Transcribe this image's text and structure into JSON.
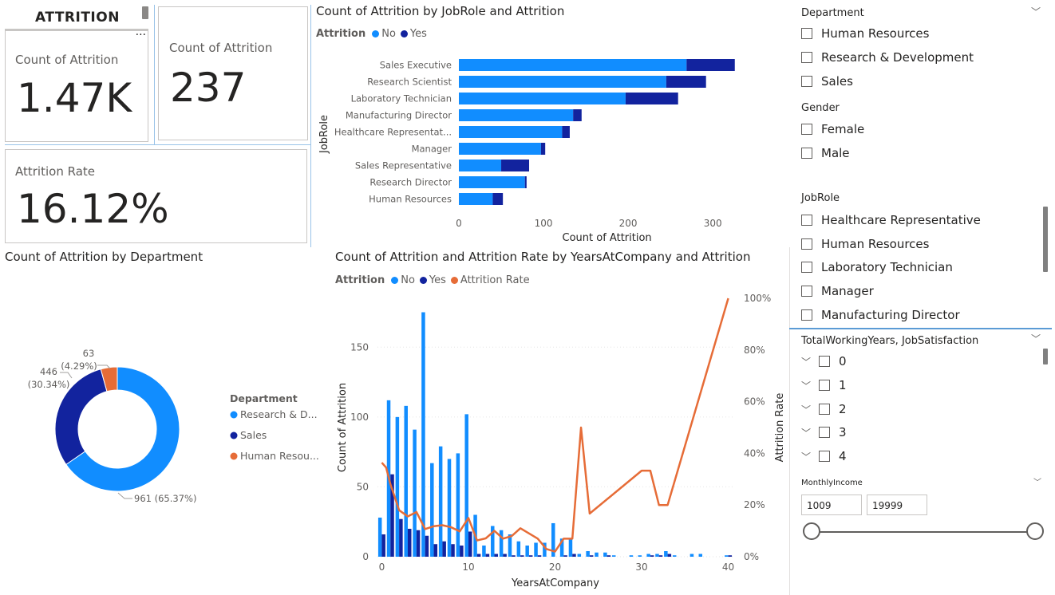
{
  "header": {
    "title": "ATTRITION"
  },
  "cards": {
    "total": {
      "label": "Count of Attrition",
      "value": "1.47K"
    },
    "yes": {
      "label": "Count of Attrition",
      "value": "237"
    },
    "rate": {
      "label": "Attrition Rate",
      "value": "16.12%"
    }
  },
  "more_options_glyph": "···",
  "colors": {
    "no": "#118DFF",
    "yes": "#12239E",
    "rate": "#E66C37",
    "hr": "#E66C37"
  },
  "jobrole_chart": {
    "title": "Count of Attrition by JobRole and Attrition",
    "legend_title": "Attrition",
    "legend_no": "No",
    "legend_yes": "Yes",
    "ylabel": "JobRole",
    "xlabel": "Count of Attrition"
  },
  "dept_chart": {
    "title": "Count of Attrition by Department",
    "legend_title": "Department",
    "legend_items": [
      "Research & D...",
      "Sales",
      "Human Resou..."
    ],
    "label_hr_count": "63",
    "label_hr_pct": "(4.29%)",
    "label_sales_count": "446",
    "label_sales_pct": "(30.34%)",
    "label_rd": "961 (65.37%)"
  },
  "years_chart": {
    "title": "Count of Attrition and Attrition Rate by YearsAtCompany and Attrition",
    "legend_title": "Attrition",
    "legend_no": "No",
    "legend_yes": "Yes",
    "legend_rate": "Attrition Rate",
    "ylabel": "Count of Attrition",
    "y2label": "Attrition Rate",
    "xlabel": "YearsAtCompany"
  },
  "slicers": {
    "department": {
      "title": "Department",
      "items": [
        "Human Resources",
        "Research & Development",
        "Sales"
      ]
    },
    "gender": {
      "title": "Gender",
      "items": [
        "Female",
        "Male"
      ]
    },
    "jobrole": {
      "title": "JobRole",
      "items": [
        "Healthcare Representative",
        "Human Resources",
        "Laboratory Technician",
        "Manager",
        "Manufacturing Director"
      ]
    },
    "twy": {
      "title": "TotalWorkingYears, JobSatisfaction",
      "items": [
        "0",
        "1",
        "2",
        "3",
        "4"
      ]
    },
    "income": {
      "title": "MonthlyIncome",
      "min": "1009",
      "max": "19999",
      "range": [
        1009,
        19999
      ]
    }
  },
  "chart_data": [
    {
      "type": "bar",
      "orientation": "horizontal",
      "stacked": true,
      "title": "Count of Attrition by JobRole and Attrition",
      "xlabel": "Count of Attrition",
      "ylabel": "JobRole",
      "categories": [
        "Sales Executive",
        "Research Scientist",
        "Laboratory Technician",
        "Manufacturing Director",
        "Healthcare Representat...",
        "Manager",
        "Sales Representative",
        "Research Director",
        "Human Resources"
      ],
      "series": [
        {
          "name": "No",
          "values": [
            269,
            245,
            197,
            135,
            122,
            97,
            50,
            78,
            40
          ]
        },
        {
          "name": "Yes",
          "values": [
            57,
            47,
            62,
            10,
            9,
            5,
            33,
            2,
            12
          ]
        }
      ],
      "xlim": [
        0,
        330
      ],
      "xticks": [
        0,
        100,
        200,
        300
      ],
      "legend": "top-left"
    },
    {
      "type": "pie",
      "donut": true,
      "title": "Count of Attrition by Department",
      "categories": [
        "Research & D...",
        "Sales",
        "Human Resou..."
      ],
      "values": [
        961,
        446,
        63
      ],
      "percents": [
        65.37,
        30.34,
        4.29
      ],
      "legend": "right"
    },
    {
      "type": "bar",
      "combo": "line",
      "title": "Count of Attrition and Attrition Rate by YearsAtCompany and Attrition",
      "xlabel": "YearsAtCompany",
      "ylabel": "Count of Attrition",
      "y2label": "Attrition Rate",
      "x": [
        0,
        1,
        2,
        3,
        4,
        5,
        6,
        7,
        8,
        9,
        10,
        11,
        12,
        13,
        14,
        15,
        16,
        17,
        18,
        19,
        20,
        21,
        22,
        23,
        24,
        25,
        26,
        27,
        29,
        30,
        31,
        32,
        33,
        34,
        36,
        37,
        40
      ],
      "series": [
        {
          "name": "No",
          "values": [
            28,
            112,
            100,
            108,
            91,
            175,
            67,
            79,
            70,
            74,
            102,
            30,
            8,
            22,
            19,
            16,
            11,
            8,
            10,
            10,
            24,
            13,
            13,
            2,
            4,
            3,
            3,
            1,
            1,
            1,
            2,
            2,
            4,
            1,
            2,
            2,
            1
          ]
        },
        {
          "name": "Yes",
          "values": [
            16,
            59,
            27,
            20,
            19,
            15,
            9,
            11,
            9,
            8,
            18,
            2,
            2,
            2,
            2,
            1,
            1,
            1,
            1,
            0,
            0,
            1,
            2,
            0,
            1,
            0,
            1,
            0,
            0,
            0,
            1,
            1,
            2,
            0,
            0,
            0,
            1
          ]
        },
        {
          "name": "Attrition Rate",
          "axis": "right",
          "values": [
            36.4,
            34.5,
            21.3,
            15.6,
            17.3,
            10.7,
            11.8,
            12.2,
            11.4,
            9.8,
            15.0,
            6.3,
            7.1,
            10.0,
            7.0,
            8.0,
            11.0,
            9.0,
            7.0,
            3.0,
            2.0,
            7.0,
            7.0,
            50.0,
            16.7,
            20.0,
            25.0,
            29.0,
            33.3,
            33.3,
            20.0,
            35.0,
            60.0,
            75.0,
            100.0
          ]
        }
      ],
      "rate_x": [
        0,
        0.5,
        1,
        2,
        3,
        4,
        5,
        6,
        7,
        8,
        9,
        10,
        11,
        12,
        13,
        14,
        15,
        16,
        17,
        18,
        19,
        20,
        21,
        22,
        23,
        24,
        30,
        31,
        32,
        33,
        40
      ],
      "rate_values": [
        36.4,
        34.5,
        28.0,
        18.0,
        15.6,
        17.3,
        10.7,
        11.8,
        12.2,
        11.4,
        9.8,
        15.0,
        6.3,
        7.1,
        10.0,
        7.0,
        8.0,
        11.0,
        9.0,
        7.0,
        3.0,
        2.0,
        7.0,
        7.0,
        50.0,
        16.7,
        33.3,
        33.3,
        20.0,
        20.0,
        100.0
      ],
      "ylim": [
        0,
        185
      ],
      "yticks": [
        0,
        50,
        100,
        150
      ],
      "y2lim": [
        0,
        100
      ],
      "y2ticks": [
        "0%",
        "20%",
        "40%",
        "60%",
        "80%",
        "100%"
      ],
      "xticks": [
        0,
        10,
        20,
        30,
        40
      ],
      "legend": "top-left"
    }
  ]
}
